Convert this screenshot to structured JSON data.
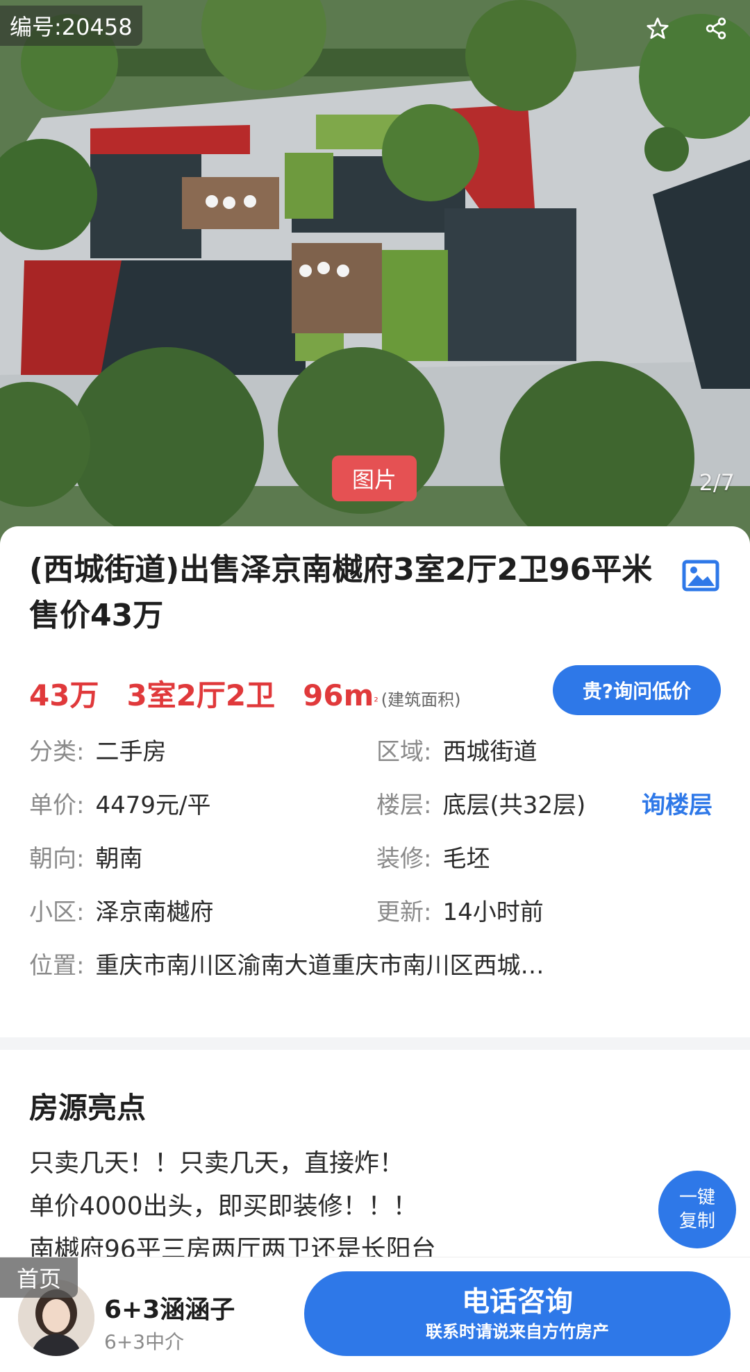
{
  "hero": {
    "listing_id": "编号:20458",
    "icons": [
      "star-icon",
      "share-icon"
    ],
    "media_tab": "图片",
    "photo_counter": "2/7"
  },
  "listing": {
    "title": "(西城街道)出售泽京南樾府3室2厅2卫96平米 售价43万",
    "price": "43万",
    "layout": "3室2厅2卫",
    "area_value": "96m",
    "area_sup": "²",
    "area_note": "(建筑面积)",
    "ask_button": "贵?询问低价"
  },
  "details": {
    "category_label": "分类:",
    "category_value": "二手房",
    "district_label": "区域:",
    "district_value": "西城街道",
    "unit_price_label": "单价:",
    "unit_price_value": "4479元/平",
    "floor_label": "楼层:",
    "floor_value": "底层(共32层)",
    "floor_link": "询楼层",
    "orientation_label": "朝向:",
    "orientation_value": "朝南",
    "decoration_label": "装修:",
    "decoration_value": "毛坯",
    "community_label": "小区:",
    "community_value": "泽京南樾府",
    "updated_label": "更新:",
    "updated_value": "14小时前",
    "location_label": "位置:",
    "location_value": "重庆市南川区渝南大道重庆市南川区西城…"
  },
  "highlights": {
    "title": "房源亮点",
    "lines": [
      "只卖几天！！只卖几天，直接炸！",
      "单价4000出头，即买即装修！！！",
      "南樾府96平三房两厅两卫还是长阳台"
    ],
    "copy_line1": "一键",
    "copy_line2": "复制"
  },
  "bottom_bar": {
    "home_tag": "首页",
    "agent_name": "6+3涵涵子",
    "agent_company": "6+3中介",
    "call_title": "电话咨询",
    "call_subtitle": "联系时请说来自方竹房产"
  },
  "colors": {
    "accent_blue": "#2e78e8",
    "price_red": "#e0393b",
    "media_tab_red": "#e55153"
  }
}
